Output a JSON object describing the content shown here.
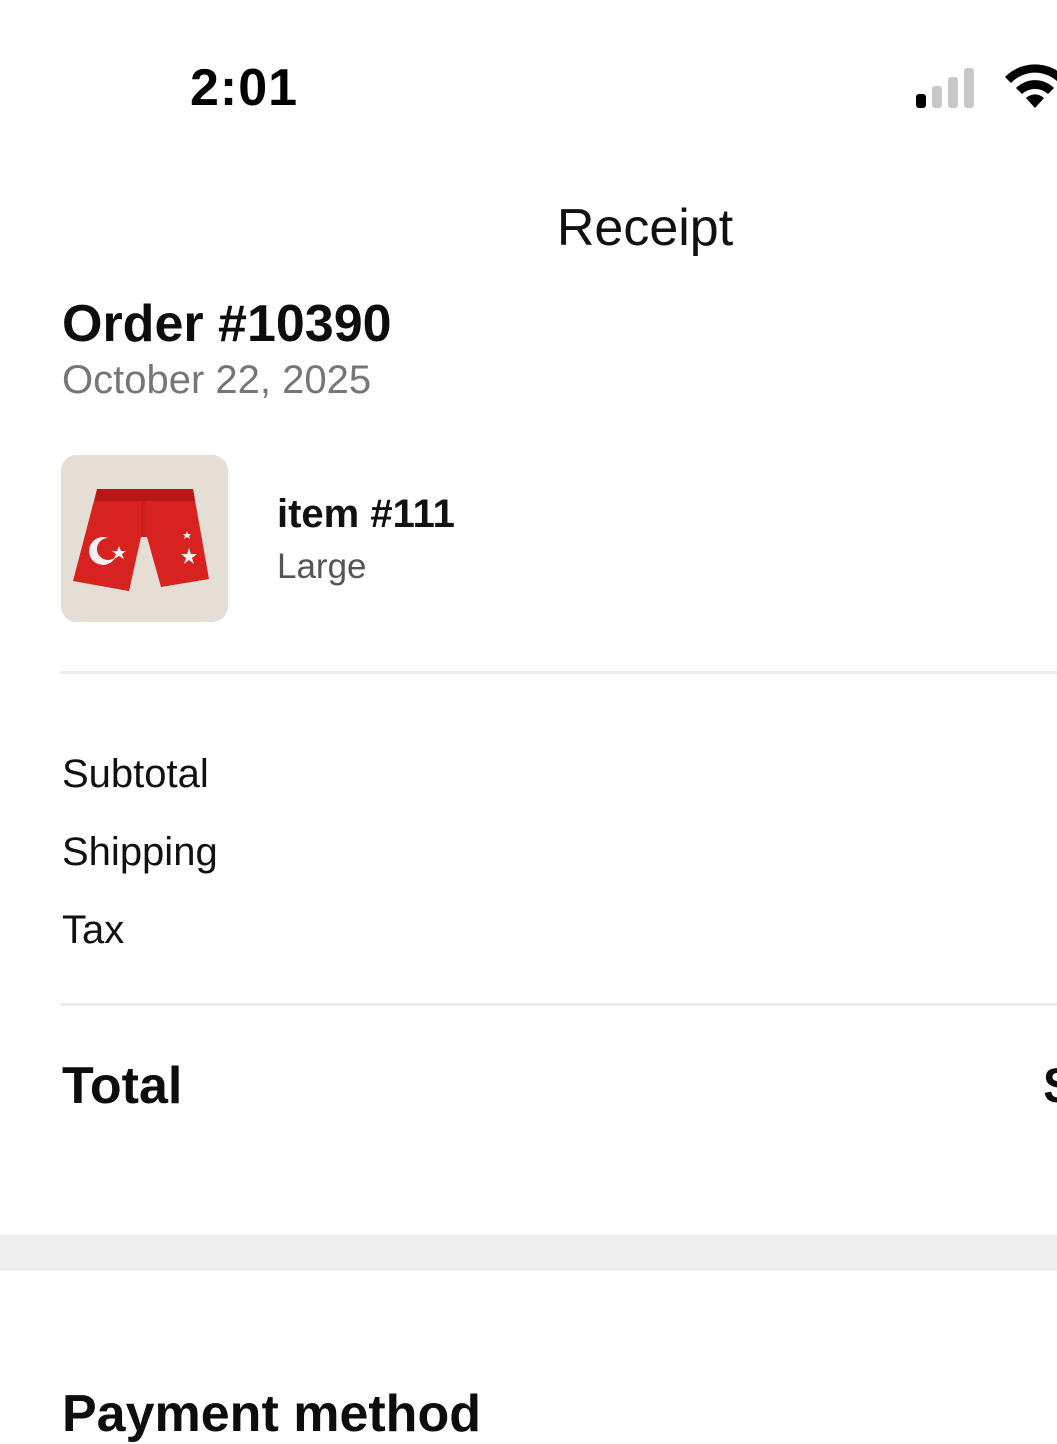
{
  "status_bar": {
    "time": "2:01",
    "signal_icon": "cellular-signal-icon",
    "wifi_icon": "wifi-icon"
  },
  "nav": {
    "title": "Receipt"
  },
  "order": {
    "title": "Order #10390",
    "date": "October 22, 2025"
  },
  "items": [
    {
      "name": "item #111",
      "variant": "Large",
      "thumbnail_icon": "red-shorts-product-image"
    }
  ],
  "summary": {
    "subtotal_label": "Subtotal",
    "shipping_label": "Shipping",
    "tax_label": "Tax",
    "total_label": "Total",
    "total_value_partial": "$"
  },
  "payment": {
    "heading": "Payment method"
  },
  "colors": {
    "background": "#ffffff",
    "muted_text": "#767676",
    "divider": "#ececec",
    "section_gap": "#efefef"
  }
}
